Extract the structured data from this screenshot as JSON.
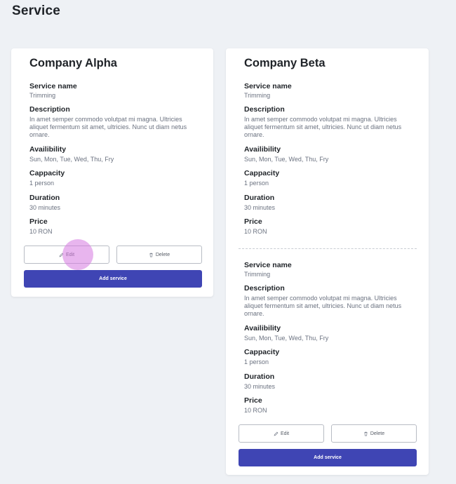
{
  "page": {
    "title": "Service"
  },
  "cards": [
    {
      "company": "Company Alpha",
      "services": [
        {
          "service_name_label": "Service name",
          "service_name": "Trimming",
          "description_label": "Description",
          "description": "In amet semper commodo volutpat mi magna. Ultricies aliquet fermentum sit amet, ultricies. Nunc ut diam netus ornare.",
          "availability_label": "Availibility",
          "availability": "Sun, Mon, Tue, Wed, Thu, Fry",
          "capacity_label": "Cappacity",
          "capacity": "1 person",
          "duration_label": "Duration",
          "duration": "30 minutes",
          "price_label": "Price",
          "price": "10 RON",
          "edit_label": "Edit",
          "delete_label": "Delete"
        }
      ],
      "add_label": "Add service"
    },
    {
      "company": "Company Beta",
      "services": [
        {
          "service_name_label": "Service name",
          "service_name": "Trimming",
          "description_label": "Description",
          "description": "In amet semper commodo volutpat mi magna. Ultricies aliquet fermentum sit amet, ultricies. Nunc ut diam netus ornare.",
          "availability_label": "Availibility",
          "availability": "Sun, Mon, Tue, Wed, Thu, Fry",
          "capacity_label": "Cappacity",
          "capacity": "1 person",
          "duration_label": "Duration",
          "duration": "30 minutes",
          "price_label": "Price",
          "price": "10 RON"
        },
        {
          "service_name_label": "Service name",
          "service_name": "Trimming",
          "description_label": "Description",
          "description": "In amet semper commodo volutpat mi magna. Ultricies aliquet fermentum sit amet, ultricies. Nunc ut diam netus ornare.",
          "availability_label": "Availibility",
          "availability": "Sun, Mon, Tue, Wed, Thu, Fry",
          "capacity_label": "Cappacity",
          "capacity": "1 person",
          "duration_label": "Duration",
          "duration": "30 minutes",
          "price_label": "Price",
          "price": "10 RON",
          "edit_label": "Edit",
          "delete_label": "Delete"
        }
      ],
      "add_label": "Add service"
    }
  ],
  "icons": {
    "edit": "pencil-icon",
    "delete": "trash-icon"
  },
  "colors": {
    "primary": "#3f45b4",
    "background": "#eef1f5",
    "click_indicator": "#d678e0"
  }
}
